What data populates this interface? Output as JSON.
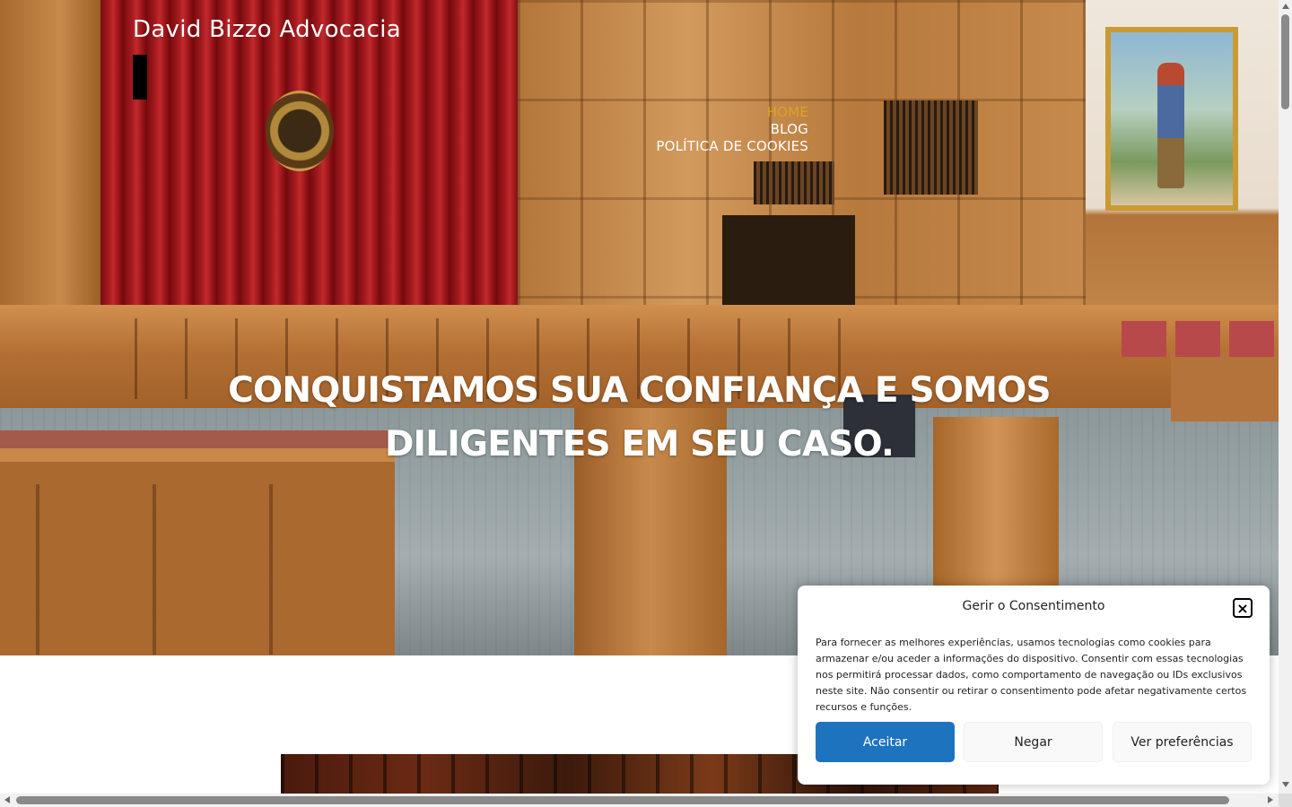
{
  "site": {
    "title": "David Bizzo Advocacia"
  },
  "nav": {
    "items": [
      {
        "label": "HOME",
        "active": true
      },
      {
        "label": "BLOG",
        "active": false
      },
      {
        "label": "POLÍTICA DE COOKIES",
        "active": false
      }
    ],
    "active_color": "#d9a521"
  },
  "hero": {
    "heading": "CONQUISTAMOS SUA CONFIANÇA E SOMOS DILIGENTES EM SEU CASO.",
    "image": "courtroom-photo"
  },
  "cookie_banner": {
    "title": "Gerir o Consentimento",
    "close_icon": "close-icon",
    "text": "Para fornecer as melhores experiências, usamos tecnologias como cookies para armazenar e/ou aceder a informações do dispositivo. Consentir com essas tecnologias nos permitirá processar dados, como comportamento de navegação ou IDs exclusivos neste site. Não consentir ou retirar o consentimento pode afetar negativamente certos recursos e funções.",
    "buttons": {
      "accept": "Aceitar",
      "deny": "Negar",
      "preferences": "Ver preferências"
    },
    "accept_color": "#1e73be"
  },
  "colors": {
    "text_light": "#ffffff",
    "background": "#ffffff"
  }
}
